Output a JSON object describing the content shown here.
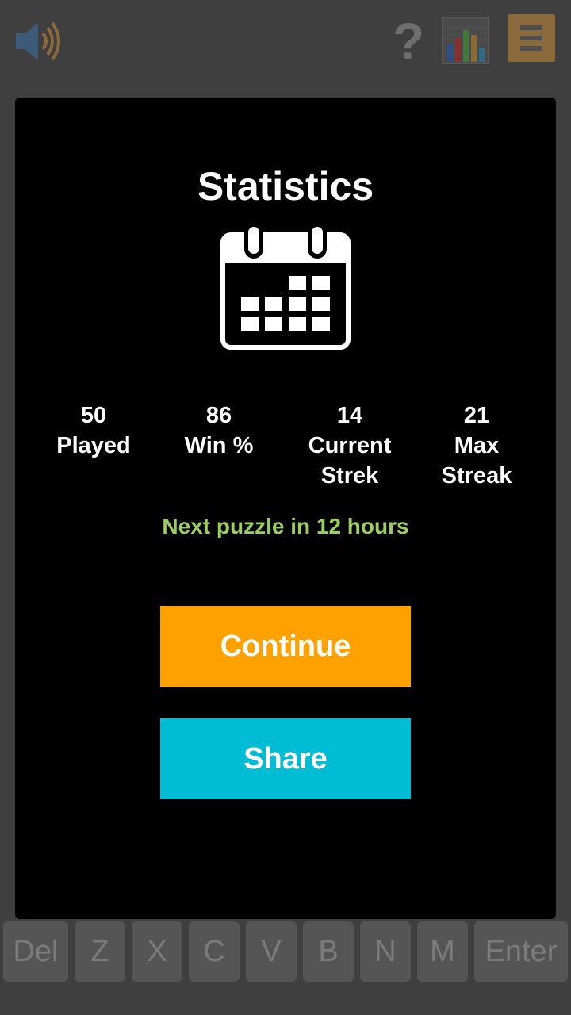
{
  "topbar": {
    "help_glyph": "?"
  },
  "stats": {
    "title": "Statistics",
    "items": [
      {
        "value": "50",
        "label": "Played"
      },
      {
        "value": "86",
        "label": "Win %"
      },
      {
        "value": "14",
        "label": "Current Strek"
      },
      {
        "value": "21",
        "label": "Max Streak"
      }
    ],
    "next_puzzle": "Next puzzle in 12 hours",
    "continue_label": "Continue",
    "share_label": "Share"
  },
  "keyboard": {
    "keys": [
      "Del",
      "Z",
      "X",
      "C",
      "V",
      "B",
      "N",
      "M",
      "Enter"
    ]
  },
  "colors": {
    "accent_orange": "#ffa100",
    "accent_cyan": "#00bcd4",
    "next_green": "#9ccf61"
  }
}
